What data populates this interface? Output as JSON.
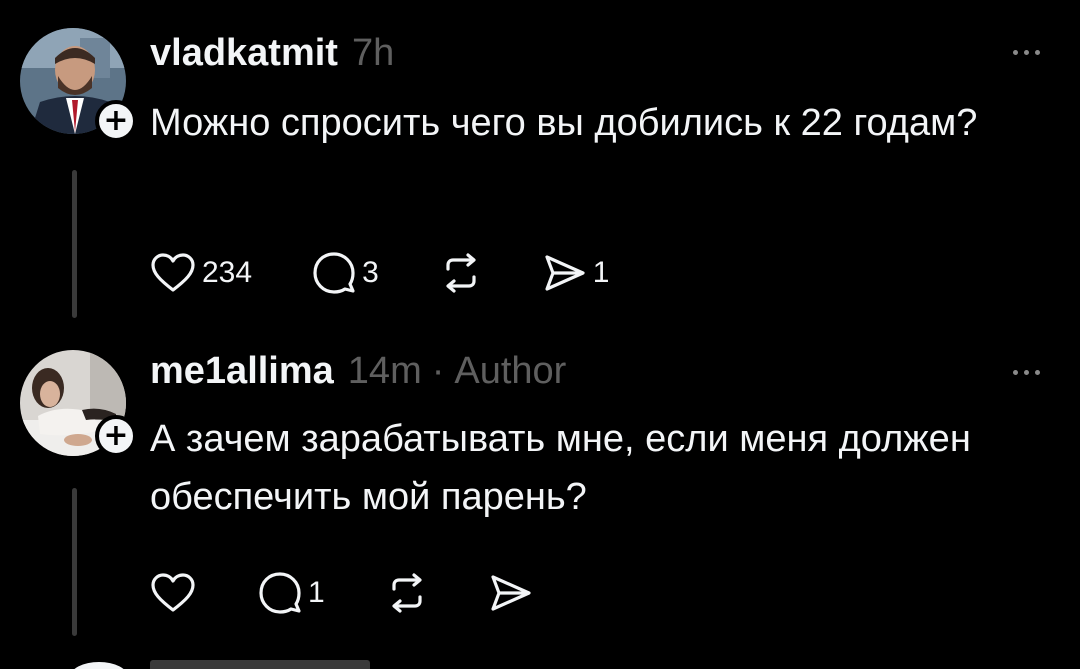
{
  "posts": [
    {
      "username": "vladkatmit",
      "timestamp": "7h",
      "is_author": false,
      "author_label": "",
      "text": "Можно спросить чего вы добились к 22 годам?",
      "likes": "234",
      "replies": "3",
      "reposts": "",
      "shares": "1"
    },
    {
      "username": "me1allima",
      "timestamp": "14m",
      "is_author": true,
      "dot": "·",
      "author_label": "Author",
      "text": "А зачем зарабатывать мне, если меня должен обеспечить мой парень?",
      "likes": "",
      "replies": "1",
      "reposts": "",
      "shares": ""
    }
  ],
  "follow_badge": "+",
  "icons": {
    "like": "heart-icon",
    "reply": "comment-icon",
    "repost": "repost-icon",
    "share": "send-icon",
    "more": "more-horizontal-icon"
  },
  "colors": {
    "background": "#000000",
    "text": "#f3f5f7",
    "muted": "#5f5f5f",
    "thread_line": "#3a3a3a"
  }
}
